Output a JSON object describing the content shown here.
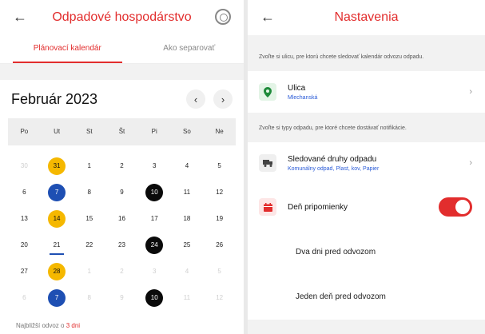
{
  "left": {
    "header": {
      "back": "←",
      "title": "Odpadové hospodárstvo"
    },
    "tabs": [
      {
        "label": "Plánovací kalendár"
      },
      {
        "label": "Ako separovať"
      }
    ],
    "month": "Február 2023",
    "nav": {
      "prev": "‹",
      "next": "›"
    },
    "weekdays": [
      "Po",
      "Ut",
      "St",
      "Št",
      "Pi",
      "So",
      "Ne"
    ],
    "days": [
      {
        "n": "30",
        "s": "muted"
      },
      {
        "n": "31",
        "s": "yellow"
      },
      {
        "n": "1",
        "s": ""
      },
      {
        "n": "2",
        "s": ""
      },
      {
        "n": "3",
        "s": ""
      },
      {
        "n": "4",
        "s": ""
      },
      {
        "n": "5",
        "s": ""
      },
      {
        "n": "6",
        "s": ""
      },
      {
        "n": "7",
        "s": "blue"
      },
      {
        "n": "8",
        "s": ""
      },
      {
        "n": "9",
        "s": ""
      },
      {
        "n": "10",
        "s": "black"
      },
      {
        "n": "11",
        "s": ""
      },
      {
        "n": "12",
        "s": ""
      },
      {
        "n": "13",
        "s": ""
      },
      {
        "n": "14",
        "s": "yellow"
      },
      {
        "n": "15",
        "s": ""
      },
      {
        "n": "16",
        "s": ""
      },
      {
        "n": "17",
        "s": ""
      },
      {
        "n": "18",
        "s": ""
      },
      {
        "n": "19",
        "s": ""
      },
      {
        "n": "20",
        "s": ""
      },
      {
        "n": "21",
        "s": "today"
      },
      {
        "n": "22",
        "s": ""
      },
      {
        "n": "23",
        "s": ""
      },
      {
        "n": "24",
        "s": "black"
      },
      {
        "n": "25",
        "s": ""
      },
      {
        "n": "26",
        "s": ""
      },
      {
        "n": "27",
        "s": ""
      },
      {
        "n": "28",
        "s": "yellow"
      },
      {
        "n": "1",
        "s": "muted"
      },
      {
        "n": "2",
        "s": "muted"
      },
      {
        "n": "3",
        "s": "muted"
      },
      {
        "n": "4",
        "s": "muted"
      },
      {
        "n": "5",
        "s": "muted"
      },
      {
        "n": "6",
        "s": "muted"
      },
      {
        "n": "7",
        "s": "blue"
      },
      {
        "n": "8",
        "s": "muted"
      },
      {
        "n": "9",
        "s": "muted"
      },
      {
        "n": "10",
        "s": "black"
      },
      {
        "n": "11",
        "s": "muted"
      },
      {
        "n": "12",
        "s": "muted"
      }
    ],
    "footer": {
      "prefix": "Najbližší odvoz o",
      "highlight": "3 dni"
    }
  },
  "right": {
    "header": {
      "back": "←",
      "title": "Nastavenia"
    },
    "street_desc": "Zvoľte si ulicu, pre ktorú chcete sledovať kalendár odvozu odpadu.",
    "street": {
      "label": "Ulica",
      "value": "Mlechanská",
      "icon": "map-pin-icon"
    },
    "types_desc": "Zvoľte si typy odpadu, pre ktoré chcete dostávať notifikácie.",
    "types": {
      "label": "Sledované druhy odpadu",
      "value": "Komunálny odpad, Plast, kov, Papier",
      "icon": "truck-icon"
    },
    "reminder": {
      "label": "Deň pripomienky",
      "icon": "calendar-icon",
      "on": true
    },
    "options": [
      "Dva dni pred odvozom",
      "Jeden deň pred odvozom"
    ],
    "chev": "›"
  },
  "colors": {
    "accent": "#e22d2d",
    "yellow": "#f5b800",
    "blue": "#1e4fb3",
    "black": "#0a0a0a",
    "link": "#2a5bd7"
  }
}
